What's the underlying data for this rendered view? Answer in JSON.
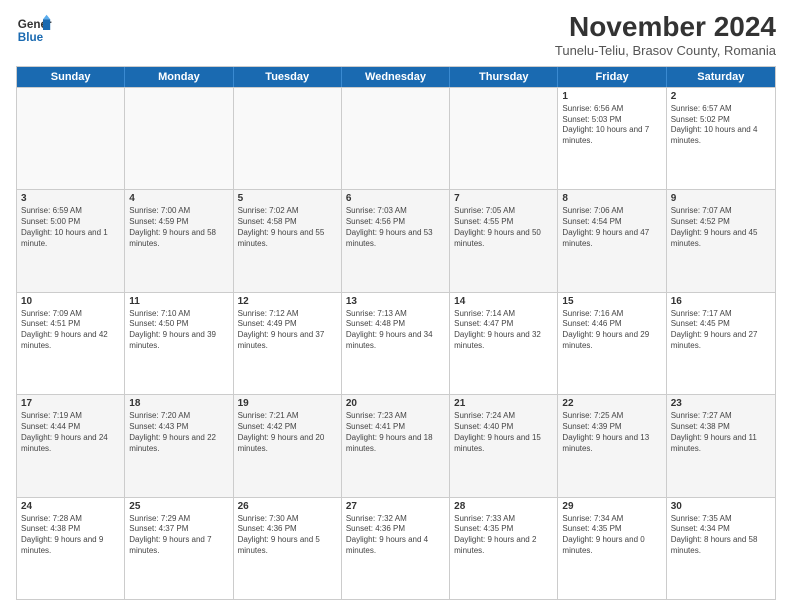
{
  "header": {
    "logo_line1": "General",
    "logo_line2": "Blue",
    "month": "November 2024",
    "location": "Tunelu-Teliu, Brasov County, Romania"
  },
  "weekdays": [
    "Sunday",
    "Monday",
    "Tuesday",
    "Wednesday",
    "Thursday",
    "Friday",
    "Saturday"
  ],
  "rows": [
    [
      {
        "day": "",
        "text": ""
      },
      {
        "day": "",
        "text": ""
      },
      {
        "day": "",
        "text": ""
      },
      {
        "day": "",
        "text": ""
      },
      {
        "day": "",
        "text": ""
      },
      {
        "day": "1",
        "text": "Sunrise: 6:56 AM\nSunset: 5:03 PM\nDaylight: 10 hours and 7 minutes."
      },
      {
        "day": "2",
        "text": "Sunrise: 6:57 AM\nSunset: 5:02 PM\nDaylight: 10 hours and 4 minutes."
      }
    ],
    [
      {
        "day": "3",
        "text": "Sunrise: 6:59 AM\nSunset: 5:00 PM\nDaylight: 10 hours and 1 minute."
      },
      {
        "day": "4",
        "text": "Sunrise: 7:00 AM\nSunset: 4:59 PM\nDaylight: 9 hours and 58 minutes."
      },
      {
        "day": "5",
        "text": "Sunrise: 7:02 AM\nSunset: 4:58 PM\nDaylight: 9 hours and 55 minutes."
      },
      {
        "day": "6",
        "text": "Sunrise: 7:03 AM\nSunset: 4:56 PM\nDaylight: 9 hours and 53 minutes."
      },
      {
        "day": "7",
        "text": "Sunrise: 7:05 AM\nSunset: 4:55 PM\nDaylight: 9 hours and 50 minutes."
      },
      {
        "day": "8",
        "text": "Sunrise: 7:06 AM\nSunset: 4:54 PM\nDaylight: 9 hours and 47 minutes."
      },
      {
        "day": "9",
        "text": "Sunrise: 7:07 AM\nSunset: 4:52 PM\nDaylight: 9 hours and 45 minutes."
      }
    ],
    [
      {
        "day": "10",
        "text": "Sunrise: 7:09 AM\nSunset: 4:51 PM\nDaylight: 9 hours and 42 minutes."
      },
      {
        "day": "11",
        "text": "Sunrise: 7:10 AM\nSunset: 4:50 PM\nDaylight: 9 hours and 39 minutes."
      },
      {
        "day": "12",
        "text": "Sunrise: 7:12 AM\nSunset: 4:49 PM\nDaylight: 9 hours and 37 minutes."
      },
      {
        "day": "13",
        "text": "Sunrise: 7:13 AM\nSunset: 4:48 PM\nDaylight: 9 hours and 34 minutes."
      },
      {
        "day": "14",
        "text": "Sunrise: 7:14 AM\nSunset: 4:47 PM\nDaylight: 9 hours and 32 minutes."
      },
      {
        "day": "15",
        "text": "Sunrise: 7:16 AM\nSunset: 4:46 PM\nDaylight: 9 hours and 29 minutes."
      },
      {
        "day": "16",
        "text": "Sunrise: 7:17 AM\nSunset: 4:45 PM\nDaylight: 9 hours and 27 minutes."
      }
    ],
    [
      {
        "day": "17",
        "text": "Sunrise: 7:19 AM\nSunset: 4:44 PM\nDaylight: 9 hours and 24 minutes."
      },
      {
        "day": "18",
        "text": "Sunrise: 7:20 AM\nSunset: 4:43 PM\nDaylight: 9 hours and 22 minutes."
      },
      {
        "day": "19",
        "text": "Sunrise: 7:21 AM\nSunset: 4:42 PM\nDaylight: 9 hours and 20 minutes."
      },
      {
        "day": "20",
        "text": "Sunrise: 7:23 AM\nSunset: 4:41 PM\nDaylight: 9 hours and 18 minutes."
      },
      {
        "day": "21",
        "text": "Sunrise: 7:24 AM\nSunset: 4:40 PM\nDaylight: 9 hours and 15 minutes."
      },
      {
        "day": "22",
        "text": "Sunrise: 7:25 AM\nSunset: 4:39 PM\nDaylight: 9 hours and 13 minutes."
      },
      {
        "day": "23",
        "text": "Sunrise: 7:27 AM\nSunset: 4:38 PM\nDaylight: 9 hours and 11 minutes."
      }
    ],
    [
      {
        "day": "24",
        "text": "Sunrise: 7:28 AM\nSunset: 4:38 PM\nDaylight: 9 hours and 9 minutes."
      },
      {
        "day": "25",
        "text": "Sunrise: 7:29 AM\nSunset: 4:37 PM\nDaylight: 9 hours and 7 minutes."
      },
      {
        "day": "26",
        "text": "Sunrise: 7:30 AM\nSunset: 4:36 PM\nDaylight: 9 hours and 5 minutes."
      },
      {
        "day": "27",
        "text": "Sunrise: 7:32 AM\nSunset: 4:36 PM\nDaylight: 9 hours and 4 minutes."
      },
      {
        "day": "28",
        "text": "Sunrise: 7:33 AM\nSunset: 4:35 PM\nDaylight: 9 hours and 2 minutes."
      },
      {
        "day": "29",
        "text": "Sunrise: 7:34 AM\nSunset: 4:35 PM\nDaylight: 9 hours and 0 minutes."
      },
      {
        "day": "30",
        "text": "Sunrise: 7:35 AM\nSunset: 4:34 PM\nDaylight: 8 hours and 58 minutes."
      }
    ]
  ]
}
